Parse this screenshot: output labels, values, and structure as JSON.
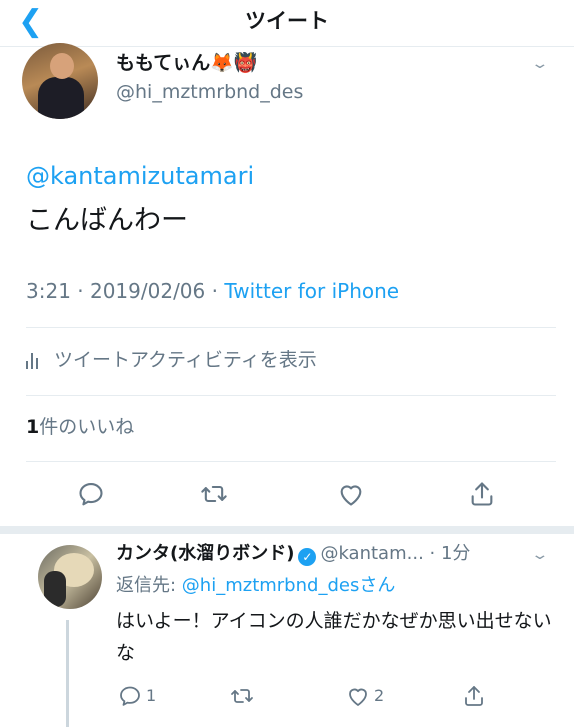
{
  "nav": {
    "back_icon": "chevron-left-icon",
    "title": "ツイート"
  },
  "tweet": {
    "display_name": "ももてぃん🦊👹",
    "handle": "@hi_mztmrbnd_des",
    "mention": "@kantamizutamari",
    "text": "こんばんわー",
    "time": "3:21 · 2019/02/06 · ",
    "source": "Twitter for iPhone",
    "activity_label": "ツイートアクティビティを表示",
    "likes_count": "1",
    "likes_label": "件のいいね",
    "actions": [
      "reply-icon",
      "retweet-icon",
      "like-icon",
      "share-icon"
    ]
  },
  "reply_tweet": {
    "display_name": "カンタ(水溜りボンド)",
    "verified": true,
    "handle_time": "@kantam... · 1分",
    "reply_prefix": "返信先: ",
    "reply_to": "@hi_mztmrbnd_des",
    "reply_suffix": "さん",
    "text": "はいよー！アイコンの人誰だかなぜか思い出せないな",
    "reply_count": "1",
    "like_count": "2"
  },
  "colors": {
    "accent": "#1da1f2",
    "secondary": "#657786",
    "divider": "#e6ecf0"
  }
}
